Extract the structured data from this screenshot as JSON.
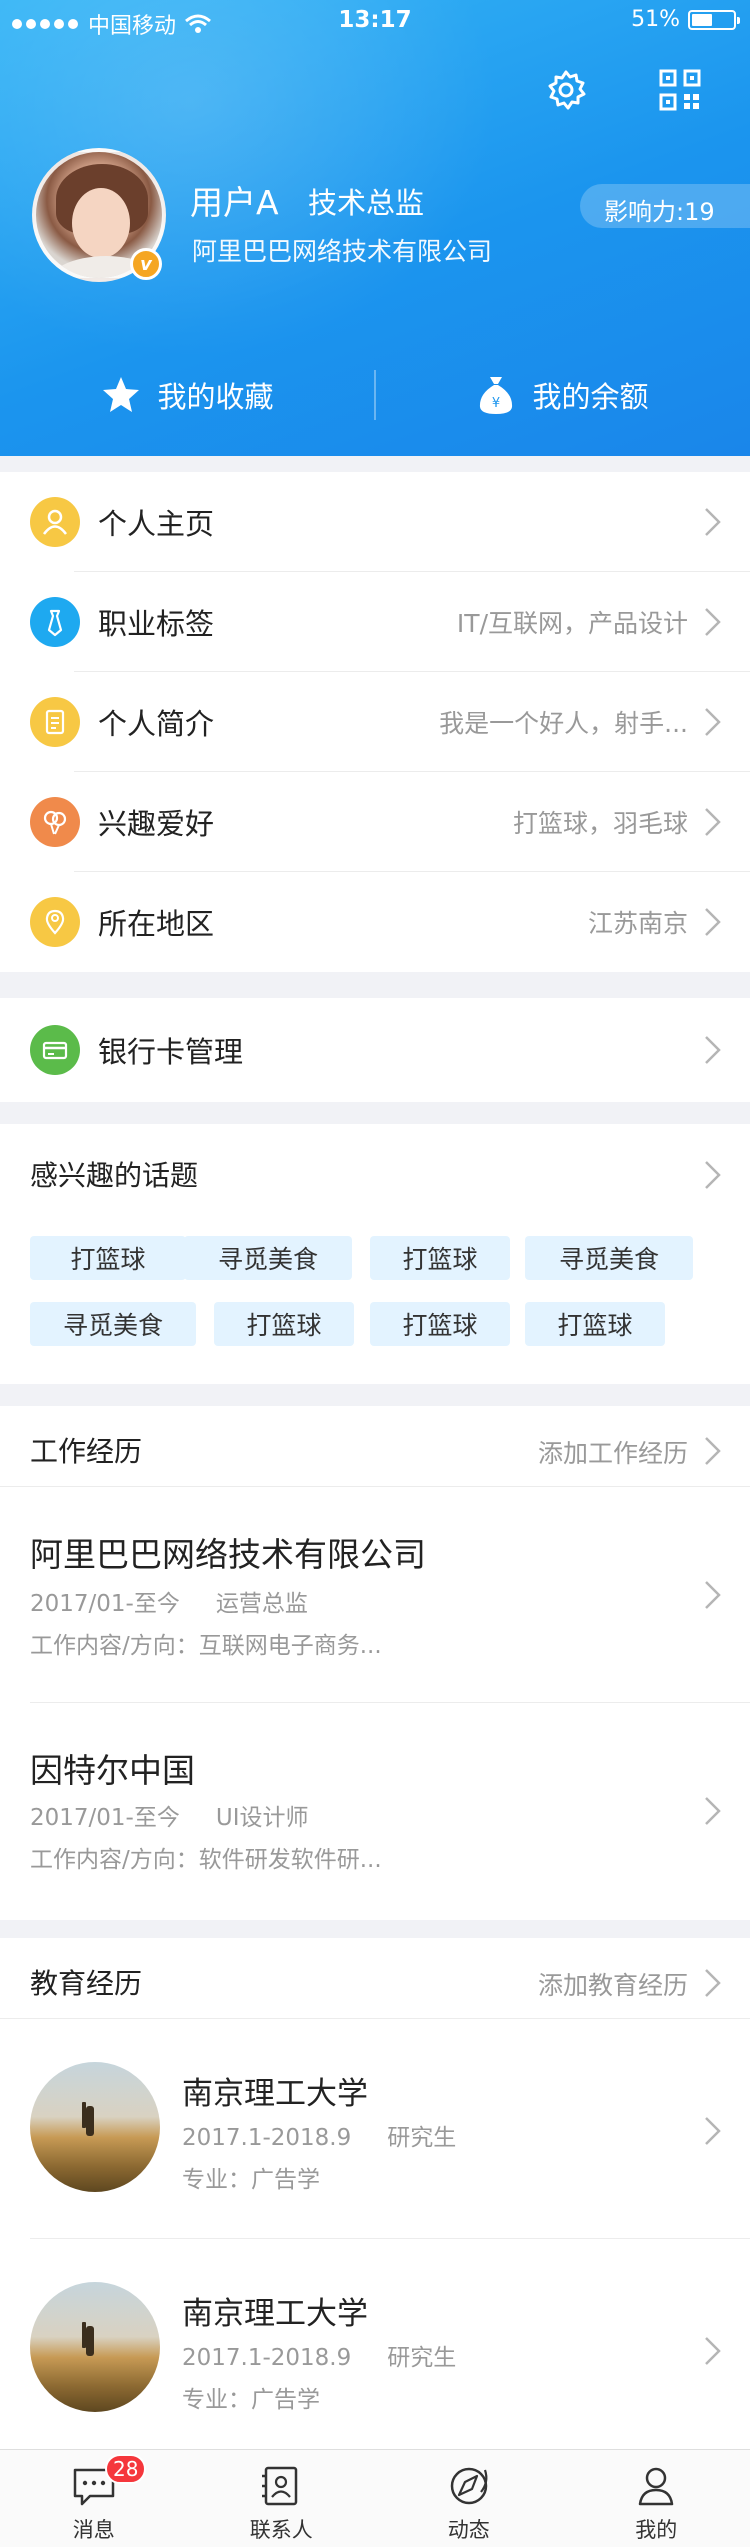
{
  "status_bar": {
    "carrier": "中国移动",
    "time": "13:17",
    "battery": "51%",
    "battery_level": 0.51
  },
  "header": {
    "user_name": "用户A",
    "user_title": "技术总监",
    "company": "阿里巴巴网络技术有限公司",
    "influence": "影响力:19",
    "verified_badge": "v",
    "icons": [
      "gear-icon",
      "qr-code-icon"
    ],
    "favorites_label": "我的收藏",
    "balance_label": "我的余额",
    "colors": {
      "header_start": "#37b6f6",
      "header_end": "#1a86ea"
    }
  },
  "profile": {
    "items": [
      {
        "label": "个人主页",
        "value": "",
        "icon": "person-icon",
        "color": "#f7c844"
      },
      {
        "label": "职业标签",
        "value": "IT/互联网，产品设计",
        "icon": "tie-icon",
        "color": "#1ea9f0"
      },
      {
        "label": "个人简介",
        "value": "我是一个好人，射手...",
        "icon": "document-icon",
        "color": "#f7c844"
      },
      {
        "label": "兴趣爱好",
        "value": "打篮球，羽毛球",
        "icon": "balloon-icon",
        "color": "#f08a4b"
      },
      {
        "label": "所在地区",
        "value": "江苏南京",
        "icon": "location-icon",
        "color": "#f7c844"
      }
    ]
  },
  "bank": {
    "label": "银行卡管理",
    "icon": "bank-card-icon",
    "color": "#5bbb4a"
  },
  "topics": {
    "title": "感兴趣的话题",
    "tags": [
      "打篮球",
      "寻觅美食",
      "打篮球",
      "寻觅美食",
      "寻觅美食",
      "打篮球",
      "打篮球",
      "打篮球"
    ]
  },
  "work": {
    "title": "工作经历",
    "action": "添加工作经历",
    "jobs": [
      {
        "company": "阿里巴巴网络技术有限公司",
        "period": "2017/01-至今",
        "role": "运营总监",
        "desc": "工作内容/方向：互联网电子商务..."
      },
      {
        "company": "因特尔中国",
        "period": "2017/01-至今",
        "role": "UI设计师",
        "desc": "工作内容/方向：软件研发软件研..."
      }
    ]
  },
  "education": {
    "title": "教育经历",
    "action": "添加教育经历",
    "schools": [
      {
        "school": "南京理工大学",
        "period": "2017.1-2018.9",
        "degree": "研究生",
        "major": "专业：广告学"
      },
      {
        "school": "南京理工大学",
        "period": "2017.1-2018.9",
        "degree": "研究生",
        "major": "专业：广告学"
      }
    ]
  },
  "tabbar": {
    "items": [
      {
        "label": "消息",
        "icon": "message-icon",
        "badge": "28"
      },
      {
        "label": "联系人",
        "icon": "contacts-icon",
        "badge": ""
      },
      {
        "label": "动态",
        "icon": "compass-icon",
        "badge": ""
      },
      {
        "label": "我的",
        "icon": "user-icon",
        "badge": ""
      }
    ]
  }
}
